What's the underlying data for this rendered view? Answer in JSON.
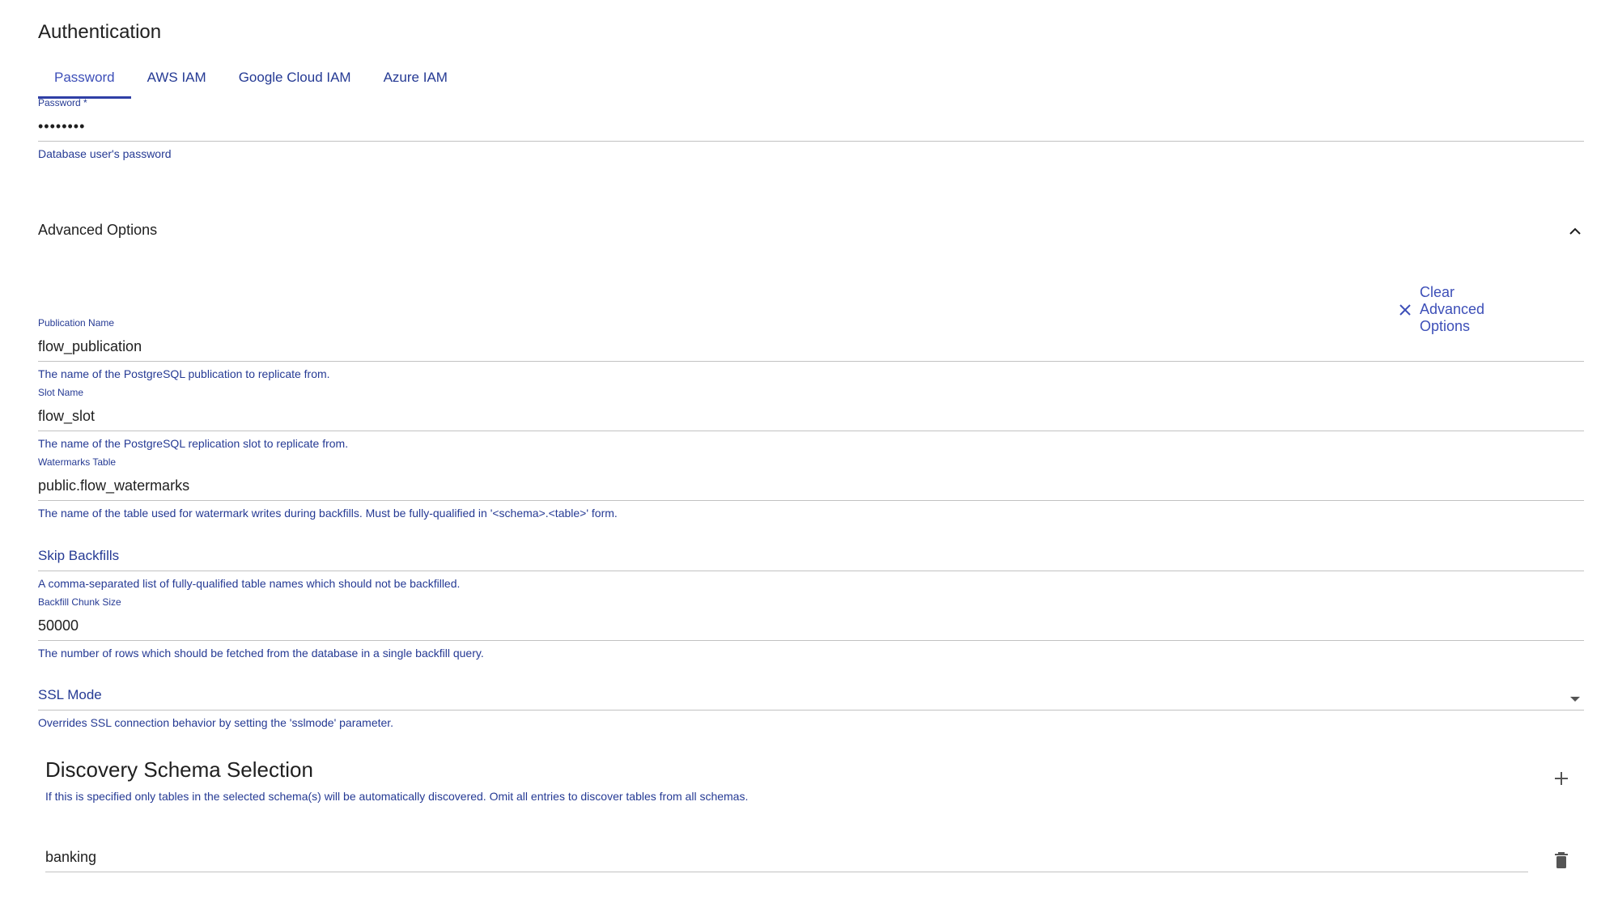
{
  "auth": {
    "title": "Authentication",
    "tabs": [
      {
        "label": "Password"
      },
      {
        "label": "AWS IAM"
      },
      {
        "label": "Google Cloud IAM"
      },
      {
        "label": "Azure IAM"
      }
    ],
    "password_label": "Password *",
    "password_value": "••••••••",
    "password_helper": "Database user's password"
  },
  "advanced": {
    "title": "Advanced Options",
    "clear_label": "Clear Advanced Options",
    "publication": {
      "label": "Publication Name",
      "value": "flow_publication",
      "helper": "The name of the PostgreSQL publication to replicate from."
    },
    "slot": {
      "label": "Slot Name",
      "value": "flow_slot",
      "helper": "The name of the PostgreSQL replication slot to replicate from."
    },
    "watermarks": {
      "label": "Watermarks Table",
      "value": "public.flow_watermarks",
      "helper": "The name of the table used for watermark writes during backfills. Must be fully-qualified in '<schema>.<table>' form."
    },
    "skip_backfills": {
      "label": "Skip Backfills",
      "helper": "A comma-separated list of fully-qualified table names which should not be backfilled."
    },
    "chunk_size": {
      "label": "Backfill Chunk Size",
      "value": "50000",
      "helper": "The number of rows which should be fetched from the database in a single backfill query."
    },
    "ssl_mode": {
      "label": "SSL Mode",
      "helper": "Overrides SSL connection behavior by setting the 'sslmode' parameter."
    }
  },
  "discovery": {
    "title": "Discovery Schema Selection",
    "helper": "If this is specified only tables in the selected schema(s) will be automatically discovered. Omit all entries to discover tables from all schemas.",
    "items": [
      {
        "value": "banking"
      }
    ]
  },
  "icons": {
    "collapse": "chevron-up-icon",
    "clear": "close-icon",
    "dropdown": "caret-down-icon",
    "add": "plus-icon",
    "delete": "trash-icon"
  },
  "colors": {
    "accent": "#253a94",
    "tab_indicator": "#2f3fa6",
    "text": "#1f1f1f",
    "divider": "#c2c2c2"
  }
}
